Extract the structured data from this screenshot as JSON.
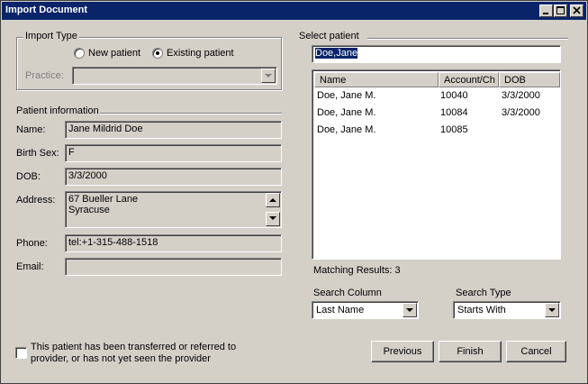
{
  "window": {
    "title": "Import Document"
  },
  "import_type": {
    "legend": "Import Type",
    "options": [
      {
        "label": "New patient",
        "selected": false
      },
      {
        "label": "Existing patient",
        "selected": true
      }
    ],
    "practice_label": "Practice:",
    "practice_value": ""
  },
  "patient_info": {
    "legend": "Patient information",
    "name_label": "Name:",
    "name_value": "Jane Mildrid Doe",
    "sex_label": "Birth Sex:",
    "sex_value": "F",
    "dob_label": "DOB:",
    "dob_value": "3/3/2000",
    "address_label": "Address:",
    "address_line1": "67 Bueller Lane",
    "address_line2": "Syracuse",
    "phone_label": "Phone:",
    "phone_value": "tel:+1-315-488-1518",
    "email_label": "Email:",
    "email_value": ""
  },
  "select_patient": {
    "legend": "Select patient",
    "search_value": "Doe,Jane",
    "columns": [
      "Name",
      "Account/Ch",
      "DOB"
    ],
    "rows": [
      {
        "name": "Doe, Jane M.",
        "account": "10040",
        "dob": "3/3/2000"
      },
      {
        "name": "Doe, Jane M.",
        "account": "10084",
        "dob": "3/3/2000"
      },
      {
        "name": "Doe, Jane M.",
        "account": "10085",
        "dob": ""
      }
    ],
    "matching_results": "Matching Results: 3",
    "search_column_label": "Search Column",
    "search_column_value": "Last Name",
    "search_type_label": "Search Type",
    "search_type_value": "Starts With"
  },
  "referral": {
    "checked": false,
    "line1": "This patient has been transferred or referred to",
    "line2": "provider, or has not yet seen the provider"
  },
  "buttons": {
    "previous": "Previous",
    "finish": "Finish",
    "cancel": "Cancel"
  },
  "colors": {
    "titlebar": "#0a246a",
    "face": "#d4d0c8",
    "selection": "#0a246a"
  }
}
